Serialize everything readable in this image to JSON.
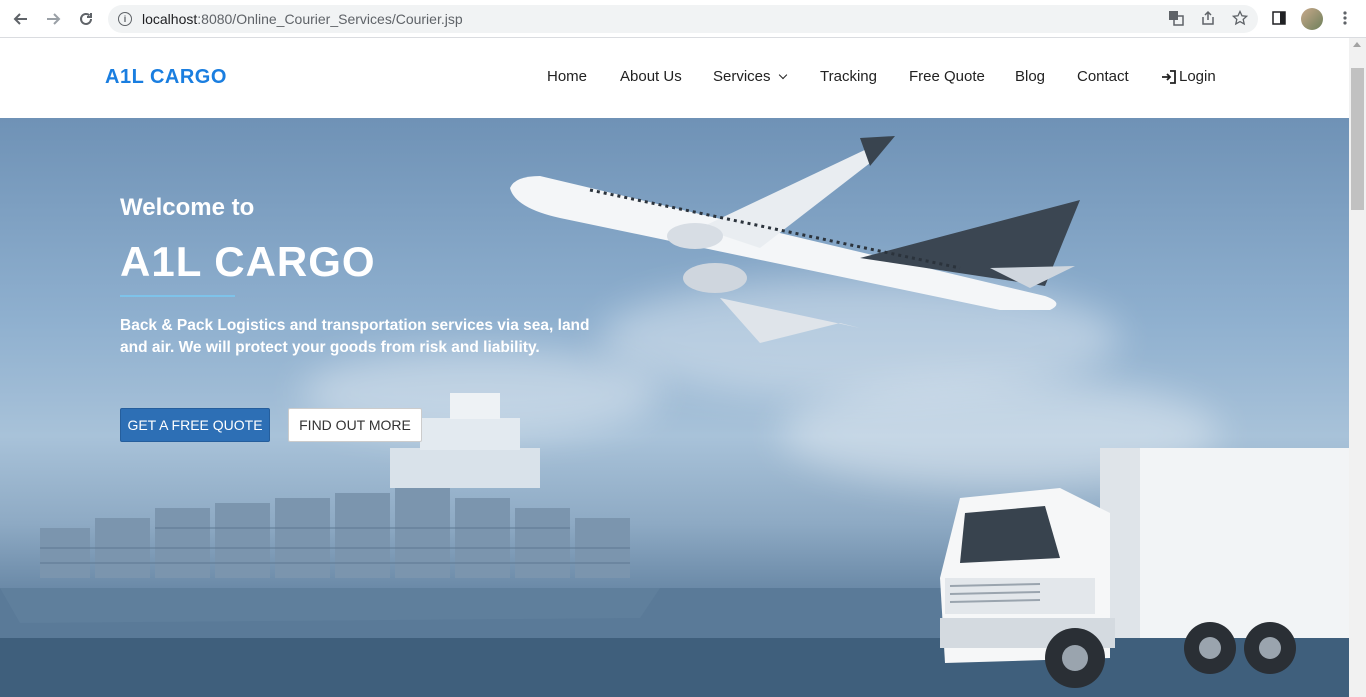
{
  "browser": {
    "url_host": "localhost",
    "url_path": ":8080/Online_Courier_Services/Courier.jsp",
    "icons": [
      "back-icon",
      "forward-icon",
      "reload-icon",
      "info-icon",
      "translate-icon",
      "share-icon",
      "star-icon",
      "side-panel-icon",
      "profile-avatar",
      "menu-dots-icon"
    ]
  },
  "site": {
    "brand": "A1L CARGO",
    "brand_color": "#1a7ee0",
    "nav": {
      "home": "Home",
      "about": "About Us",
      "services": "Services",
      "tracking": "Tracking",
      "quote": "Free Quote",
      "blog": "Blog",
      "contact": "Contact",
      "login": "Login"
    }
  },
  "hero": {
    "welcome": "Welcome to",
    "title": "A1L CARGO",
    "description": "Back & Pack Logistics and transportation services via sea, land and air. We will protect your goods from risk and liability.",
    "primary_button": "GET A FREE QUOTE",
    "secondary_button": "FIND OUT MORE",
    "accent_color": "#2d6fb5"
  }
}
